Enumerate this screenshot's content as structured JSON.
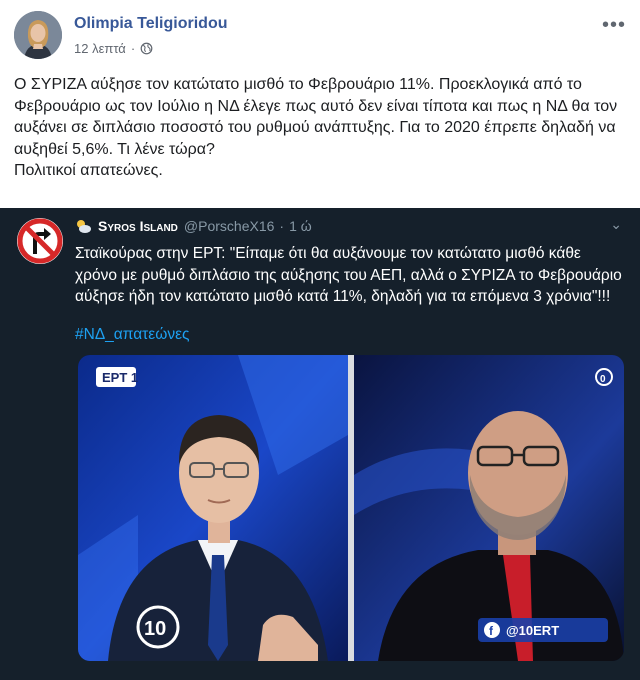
{
  "post": {
    "author": "Olimpia Teligioridou",
    "time": "12 λεπτά",
    "separator": "·",
    "text": [
      "Ο ΣΥΡΙΖΑ αύξησε τον κατώτατο μισθό το Φεβρουάριο 11%. Προεκλογικά από το Φεβρουάριο ως τον Ιούλιο η ΝΔ έλεγε πως αυτό δεν είναι τίποτα και πως η ΝΔ θα τον αυξάνει σε διπλάσιο ποσοστό του ρυθμού ανάπτυξης. Για το 2020 έπρεπε δηλαδή να αυξηθεί 5,6%. Τι λένε τώρα?",
      "Πολιτικοί απατεώνες."
    ],
    "more_icon": "•••"
  },
  "tweet": {
    "name": "Syros Island",
    "handle": "@PorscheX16",
    "separator": "·",
    "time": "1 ώ",
    "chevron": "⌄",
    "text": "Σταϊκούρας στην ΕΡΤ: \"Είπαμε ότι θα αυξάνουμε τον κατώτατο μισθό κάθε χρόνο με ρυθμό διπλάσιο της αύξησης του ΑΕΠ, αλλά ο ΣΥΡΙΖΑ το Φεβρουάριο αύξησε ήδη τον κατώτατο μισθό κατά 11%, δηλαδή για τα επόμενα 3 χρόνια\"!!!",
    "hashtag": "#ΝΔ_απατεώνες",
    "media": {
      "channel_logo": "ΕΡΤ 1",
      "corner_badge": "0",
      "bottom_logo": "10",
      "social_tag": "@10ERT",
      "social_icon": "f"
    }
  },
  "colors": {
    "author_link": "#385898",
    "tweet_bg": "#15202b",
    "hashtag": "#1da1f2",
    "meta_text": "#616770"
  }
}
